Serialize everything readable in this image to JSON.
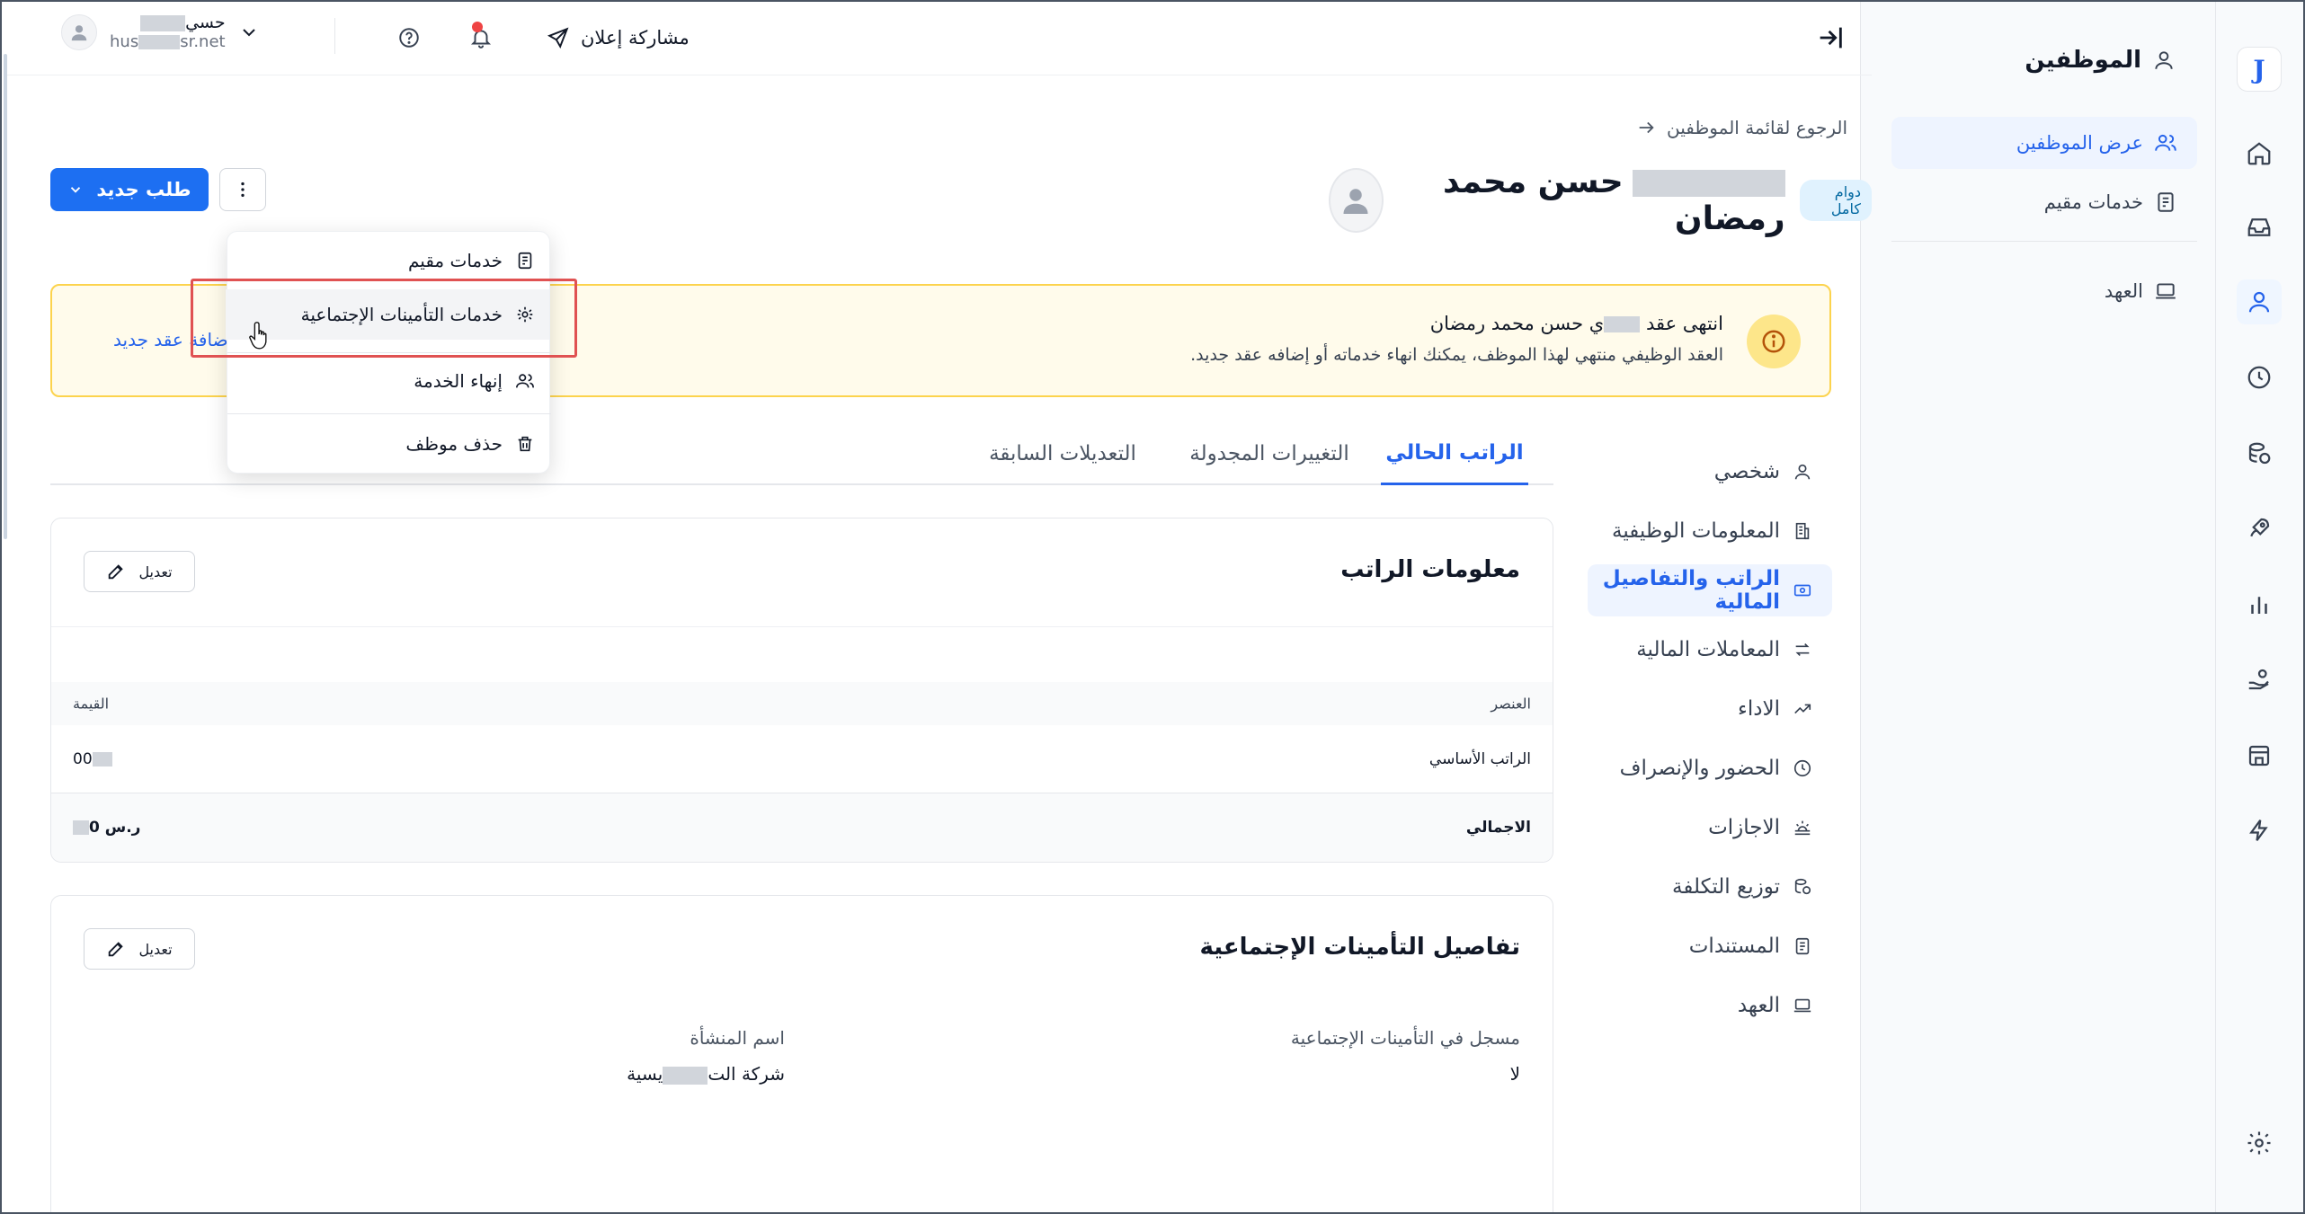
{
  "topbar": {
    "share_label": "مشاركة إعلان",
    "user_name": "حسي",
    "user_email_start": "hus",
    "user_email_end": "sr.net"
  },
  "rail": {
    "logo": "J",
    "items": [
      "home-icon",
      "inbox-icon",
      "person-icon",
      "clock-icon",
      "coins-icon",
      "rocket-icon",
      "chart-icon",
      "hand-coin-icon",
      "store-icon",
      "bolt-icon",
      "settings-icon"
    ]
  },
  "subnav": {
    "title": "الموظفين",
    "items": [
      {
        "label": "عرض الموظفين",
        "icon": "users-icon"
      },
      {
        "label": "خدمات مقيم",
        "icon": "document-icon"
      },
      {
        "label": "العهد",
        "icon": "laptop-icon"
      }
    ]
  },
  "back_link": "الرجوع لقائمة الموظفين",
  "employee": {
    "name": "حسن محمد رمضان",
    "badge": "دوام كامل"
  },
  "actions": {
    "new_request": "طلب جديد"
  },
  "dropdown": {
    "items": [
      {
        "label": "خدمات مقيم",
        "icon": "document-icon"
      },
      {
        "label": "خدمات التأمينات الإجتماعية",
        "icon": "gear-icon"
      },
      {
        "label": "إنهاء الخدمة",
        "icon": "users-icon"
      },
      {
        "label": "حذف موظف",
        "icon": "trash-icon"
      }
    ]
  },
  "alert": {
    "title_start": "انتهى عقد",
    "title_mid": "ي حسن محمد رمضان",
    "text": "العقد الوظيفي منتهي لهذا الموظف، يمكنك انهاء خدماته أو إضافه عقد جديد.",
    "link": "إضافة عقد جديد"
  },
  "page_nav": [
    {
      "label": "شخصي",
      "icon": "person-icon"
    },
    {
      "label": "المعلومات الوظيفية",
      "icon": "building-icon"
    },
    {
      "label": "الراتب والتفاصيل المالية",
      "icon": "money-icon",
      "active": true
    },
    {
      "label": "المعاملات المالية",
      "icon": "transfer-icon"
    },
    {
      "label": "الاداء",
      "icon": "trend-icon"
    },
    {
      "label": "الحضور والإنصراف",
      "icon": "clock-icon"
    },
    {
      "label": "الاجازات",
      "icon": "sun-icon"
    },
    {
      "label": "توزيع التكلفة",
      "icon": "coins-icon"
    },
    {
      "label": "المستندات",
      "icon": "file-icon"
    },
    {
      "label": "العهد",
      "icon": "laptop-icon"
    }
  ],
  "tabs": [
    {
      "label": "الراتب الحالي",
      "active": true
    },
    {
      "label": "التغييرات المجدولة"
    },
    {
      "label": "التعديلات السابقة"
    }
  ],
  "salary_card": {
    "title": "معلومات الراتب",
    "edit": "تعديل",
    "col_item": "العنصر",
    "col_value": "القيمة",
    "rows": [
      {
        "item": "الراتب الأساسي",
        "value": "00"
      },
      {
        "item": "الاجمالي",
        "value": "ر.س 0"
      }
    ]
  },
  "insurance_card": {
    "title": "تفاصيل التأمينات الإجتماعية",
    "edit": "تعديل",
    "registered_label": "مسجل في التأمينات الإجتماعية",
    "registered_value": "لا",
    "org_label": "اسم المنشأة",
    "org_value_start": "شركة الت",
    "org_value_end": "يسية"
  }
}
